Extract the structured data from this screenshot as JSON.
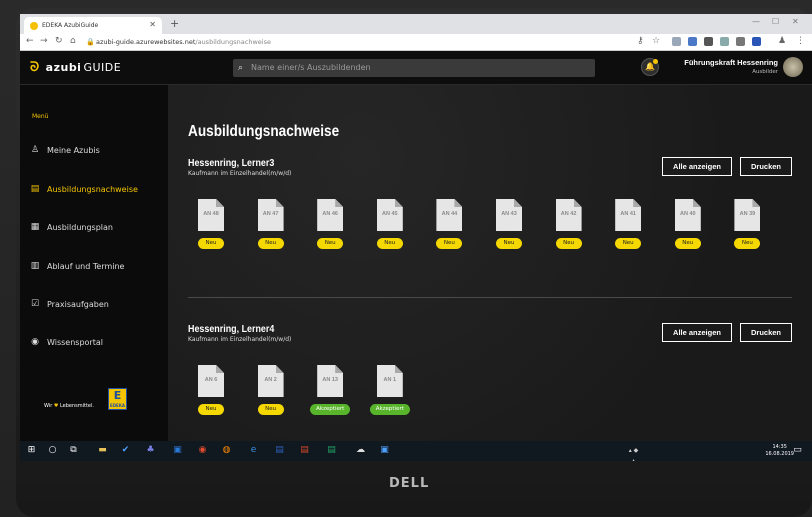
{
  "browser": {
    "tab_title": "EDEKA AzubiGuide",
    "url_host": "azubi-guide.azurewebsites.net",
    "url_path": "/ausbildungsnachweise"
  },
  "header": {
    "logo_bold": "azubi",
    "logo_rest": "GUIDE",
    "search_placeholder": "Name einer/s Auszubildenden",
    "user_name": "Führungskraft Hessenring",
    "user_role": "Ausbilder"
  },
  "sidebar": {
    "menu_label": "Menü",
    "items": [
      {
        "label": "Meine Azubis",
        "icon": "user-icon"
      },
      {
        "label": "Ausbildungsnachweise",
        "icon": "document-icon",
        "active": true
      },
      {
        "label": "Ausbildungsplan",
        "icon": "plan-icon"
      },
      {
        "label": "Ablauf und Termine",
        "icon": "calendar-icon"
      },
      {
        "label": "Praxisaufgaben",
        "icon": "task-icon"
      },
      {
        "label": "Wissensportal",
        "icon": "bulb-icon"
      }
    ],
    "footer_slogan_a": "Wir",
    "footer_slogan_b": "Lebensmittel.",
    "brand": "EDEKA"
  },
  "main": {
    "title": "Ausbildungsnachweise",
    "sections": [
      {
        "name": "Hessenring, Lerner3",
        "job": "Kaufmann im Einzelhandel(m/w/d)",
        "show_all": "Alle anzeigen",
        "print": "Drucken",
        "docs": [
          {
            "label": "AN 48",
            "status": "Neu"
          },
          {
            "label": "AN 47",
            "status": "Neu"
          },
          {
            "label": "AN 46",
            "status": "Neu"
          },
          {
            "label": "AN 45",
            "status": "Neu"
          },
          {
            "label": "AN 44",
            "status": "Neu"
          },
          {
            "label": "AN 43",
            "status": "Neu"
          },
          {
            "label": "AN 42",
            "status": "Neu"
          },
          {
            "label": "AN 41",
            "status": "Neu"
          },
          {
            "label": "AN 40",
            "status": "Neu"
          },
          {
            "label": "AN 39",
            "status": "Neu"
          }
        ]
      },
      {
        "name": "Hessenring, Lerner4",
        "job": "Kaufmann im Einzelhandel(m/w/d)",
        "show_all": "Alle anzeigen",
        "print": "Drucken",
        "docs": [
          {
            "label": "AN 6",
            "status": "Neu"
          },
          {
            "label": "AN 2",
            "status": "Neu"
          },
          {
            "label": "AN 13",
            "status": "Akzeptiert"
          },
          {
            "label": "AN 1",
            "status": "Akzeptiert"
          }
        ]
      }
    ]
  },
  "taskbar": {
    "time": "14:35",
    "date": "16.08.2019"
  },
  "monitor_brand": "DELL",
  "colors": {
    "accent": "#f5c400",
    "new_badge": "#f5d800",
    "accepted_badge": "#58b52b"
  }
}
